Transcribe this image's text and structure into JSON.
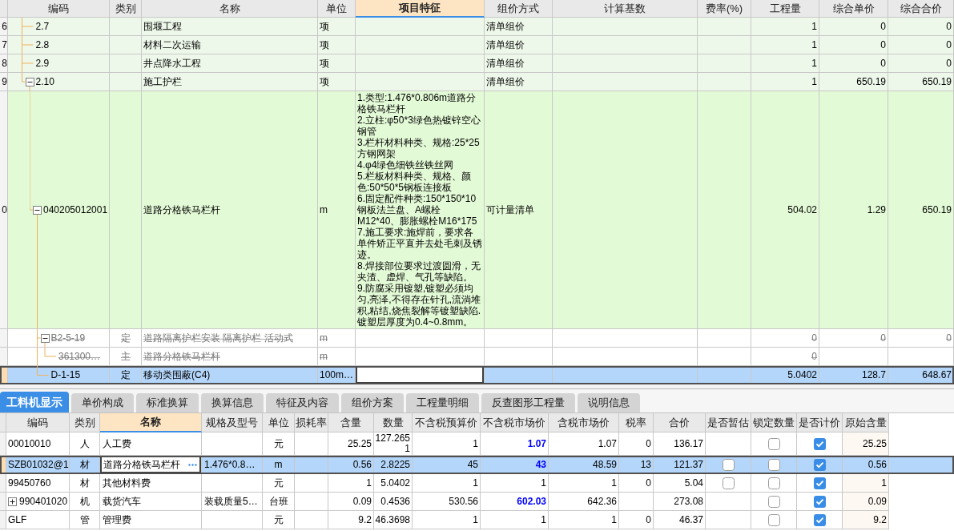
{
  "top_table": {
    "columns": [
      {
        "label": "编码",
        "selected": false
      },
      {
        "label": "类别",
        "selected": false
      },
      {
        "label": "名称",
        "selected": false
      },
      {
        "label": "单位",
        "selected": false
      },
      {
        "label": "项目特征",
        "selected": true
      },
      {
        "label": "组价方式",
        "selected": false
      },
      {
        "label": "计算基数",
        "selected": false
      },
      {
        "label": "费率(%)",
        "selected": false
      },
      {
        "label": "工程量",
        "selected": false
      },
      {
        "label": "综合单价",
        "selected": false
      },
      {
        "label": "综合合价",
        "selected": false
      }
    ],
    "rows": [
      {
        "row_number": "6",
        "kind": "section",
        "code": "2.7",
        "name": "围堰工程",
        "unit": "项",
        "pricing_method": "清单组价",
        "quantity": "1",
        "unit_price": "0",
        "total": "0",
        "struck_out": false,
        "selected": false
      },
      {
        "row_number": "7",
        "kind": "section",
        "code": "2.8",
        "name": "材料二次运输",
        "unit": "项",
        "pricing_method": "清单组价",
        "quantity": "1",
        "unit_price": "0",
        "total": "0",
        "struck_out": false,
        "selected": false
      },
      {
        "row_number": "8",
        "kind": "section",
        "code": "2.9",
        "name": "井点降水工程",
        "unit": "项",
        "pricing_method": "清单组价",
        "quantity": "1",
        "unit_price": "0",
        "total": "0",
        "struck_out": false,
        "selected": false
      },
      {
        "row_number": "9",
        "kind": "section",
        "code": "2.10",
        "name": "施工护栏",
        "unit": "项",
        "pricing_method": "清单组价",
        "quantity": "1",
        "unit_price": "650.19",
        "total": "650.19",
        "struck_out": false,
        "selected": false,
        "expanded": true,
        "children": [
          {
            "row_number": "0",
            "kind": "bill_item",
            "code": "040205012001",
            "name": "道路分格铁马栏杆",
            "unit": "m",
            "features": [
              "1.类型:1.476*0.806m道路分格铁马栏杆",
              "2.立柱:φ50*3绿色热镀锌空心钢管",
              "3.栏杆材料种类、规格:25*25方钢网架",
              "4.φ4绿色细铁丝铁丝网",
              "5.栏板材料种类、规格、颜色:50*50*5钢板连接板",
              "6.固定配件种类:150*150*10钢板法兰盘、A螺栓M12*40、膨胀螺栓M16*175",
              "7.施工要求:施焊前，要求各单件矫正平直并去处毛刺及锈迹。",
              "8.焊接部位要求过渡圆滑，无夹渣、虚焊、气孔等缺陷。",
              "9.防腐采用镀塑,镀塑必须均匀,亮泽,不得存在针孔,流淌堆积,粘结,烧焦裂解等镀塑缺陷.镀塑层厚度为0.4~0.8mm。"
            ],
            "pricing_method": "可计量清单",
            "quantity": "504.02",
            "unit_price": "1.29",
            "total": "650.19",
            "struck_out": false,
            "selected": false,
            "expanded": true,
            "children": [
              {
                "code": "B2-5-19",
                "type": "定",
                "name": "道路隔离护栏安装 隔离护栏 活动式",
                "unit": "m",
                "quantity": "0",
                "unit_price": "0",
                "total": "0",
                "struck_out": true,
                "selected": false,
                "expanded": true,
                "children": [
                  {
                    "code": "361300…",
                    "type": "主",
                    "name": "道路分格铁马栏杆",
                    "unit": "m",
                    "quantity": "0",
                    "struck_out": true,
                    "selected": false
                  }
                ]
              },
              {
                "code": "D-1-15",
                "type": "定",
                "name": "移动类围蔽(C4)",
                "unit": "100m…",
                "quantity": "5.0402",
                "unit_price": "128.7",
                "total": "648.67",
                "struck_out": false,
                "selected": true
              }
            ]
          }
        ]
      }
    ]
  },
  "detail_tabs": [
    {
      "label": "工料机显示",
      "selected": true
    },
    {
      "label": "单价构成",
      "selected": false
    },
    {
      "label": "标准换算",
      "selected": false
    },
    {
      "label": "换算信息",
      "selected": false
    },
    {
      "label": "特征及内容",
      "selected": false
    },
    {
      "label": "组价方案",
      "selected": false
    },
    {
      "label": "工程量明细",
      "selected": false
    },
    {
      "label": "反查图形工程量",
      "selected": false
    },
    {
      "label": "说明信息",
      "selected": false
    }
  ],
  "detail_table": {
    "columns": [
      {
        "label": "编码",
        "selected": false
      },
      {
        "label": "类别",
        "selected": false
      },
      {
        "label": "名称",
        "selected": true
      },
      {
        "label": "规格及型号",
        "selected": false
      },
      {
        "label": "单位",
        "selected": false
      },
      {
        "label": "损耗率",
        "selected": false
      },
      {
        "label": "含量",
        "selected": false
      },
      {
        "label": "数量",
        "selected": false
      },
      {
        "label": "不含税预算价",
        "selected": false
      },
      {
        "label": "不含税市场价",
        "selected": false
      },
      {
        "label": "含税市场价",
        "selected": false
      },
      {
        "label": "税率",
        "selected": false
      },
      {
        "label": "合价",
        "selected": false
      },
      {
        "label": "是否暂估",
        "selected": false
      },
      {
        "label": "锁定数量",
        "selected": false
      },
      {
        "label": "是否计价",
        "selected": false
      },
      {
        "label": "原始含量",
        "selected": false
      }
    ],
    "rows": [
      {
        "code": "00010010",
        "type": "人",
        "name": "人工费",
        "unit": "元",
        "content": "25.25",
        "quantity": "127.2651",
        "budget_price": "1",
        "market_price": "1.07",
        "market_price_changed": true,
        "market_price_with_tax": "1.07",
        "tax_rate": "0",
        "total": "136.17",
        "lock_quantity": false,
        "priced": true,
        "original_content": "25.25",
        "selected": false
      },
      {
        "code": "SZB01032@1",
        "type": "材",
        "name": "道路分格铁马栏杆",
        "spec": "1.476*0.8…",
        "unit": "m",
        "content": "0.56",
        "quantity": "2.8225",
        "budget_price": "45",
        "market_price": "43",
        "market_price_changed": true,
        "market_price_with_tax": "48.59",
        "tax_rate": "13",
        "total": "121.37",
        "provisional": false,
        "lock_quantity": false,
        "priced": true,
        "original_content": "0.56",
        "selected": true
      },
      {
        "code": "99450760",
        "type": "材",
        "name": "其他材料费",
        "unit": "元",
        "content": "1",
        "quantity": "5.0402",
        "budget_price": "1",
        "market_price": "1",
        "market_price_changed": false,
        "market_price_with_tax": "1",
        "tax_rate": "0",
        "total": "5.04",
        "provisional": false,
        "lock_quantity": false,
        "priced": true,
        "original_content": "1",
        "selected": false
      },
      {
        "code": "990401020",
        "expanded": false,
        "type": "机",
        "name": "载货汽车",
        "spec": "装载质量5…",
        "unit": "台班",
        "content": "0.09",
        "quantity": "0.4536",
        "budget_price": "530.56",
        "market_price": "602.03",
        "market_price_changed": true,
        "market_price_with_tax": "642.36",
        "total": "273.08",
        "lock_quantity": false,
        "priced": true,
        "original_content": "0.09",
        "selected": false
      },
      {
        "code": "GLF",
        "type": "管",
        "name": "管理费",
        "unit": "元",
        "content": "9.2",
        "quantity": "46.3698",
        "budget_price": "1",
        "market_price": "1",
        "market_price_changed": false,
        "market_price_with_tax": "1",
        "tax_rate": "0",
        "total": "46.37",
        "lock_quantity": false,
        "priced": true,
        "original_content": "9.2",
        "selected": false
      }
    ]
  }
}
